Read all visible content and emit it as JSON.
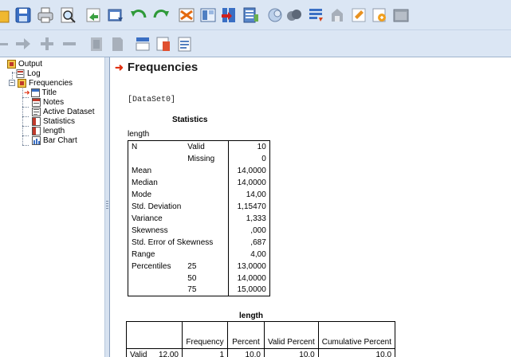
{
  "toolbar_row1": {
    "icons": [
      "open-folder-icon",
      "save-icon",
      "print-icon",
      "print-preview-icon",
      "export-icon",
      "recall-dialog-icon",
      "undo-icon",
      "redo-icon",
      "goto-case-icon",
      "goto-variable-icon",
      "split-file-icon",
      "weight-cases-icon",
      "select-cases-icon",
      "value-labels-icon",
      "use-sets-icon",
      "show-all-variables-icon",
      "spell-check-icon",
      "scripts-icon",
      "designate-window-icon"
    ]
  },
  "toolbar_row2": {
    "icons": [
      "promote-icon",
      "demote-icon",
      "expand-icon",
      "collapse-icon",
      "show-icon",
      "hide-icon",
      "insert-heading-icon",
      "insert-title-icon",
      "insert-text-icon"
    ]
  },
  "outline": {
    "root": "Output",
    "log": "Log",
    "frequencies": "Frequencies",
    "children": [
      "Title",
      "Notes",
      "Active Dataset",
      "Statistics",
      "length",
      "Bar Chart"
    ]
  },
  "output": {
    "heading": "Frequencies",
    "dataset": "[DataSet0]",
    "statistics": {
      "title": "Statistics",
      "variable": "length",
      "rows": [
        {
          "c1": "N",
          "c2": "Valid",
          "value": "10"
        },
        {
          "c1": "",
          "c2": "Missing",
          "value": "0"
        },
        {
          "c1": "Mean",
          "c2": "",
          "value": "14,0000"
        },
        {
          "c1": "Median",
          "c2": "",
          "value": "14,0000"
        },
        {
          "c1": "Mode",
          "c2": "",
          "value": "14,00"
        },
        {
          "c1": "Std. Deviation",
          "c2": "",
          "value": "1,15470"
        },
        {
          "c1": "Variance",
          "c2": "",
          "value": "1,333"
        },
        {
          "c1": "Skewness",
          "c2": "",
          "value": ",000"
        },
        {
          "c1": "Std. Error of Skewness",
          "c2": "",
          "value": ",687"
        },
        {
          "c1": "Range",
          "c2": "",
          "value": "4,00"
        },
        {
          "c1": "Percentiles",
          "c2": "25",
          "value": "13,0000"
        },
        {
          "c1": "",
          "c2": "50",
          "value": "14,0000"
        },
        {
          "c1": "",
          "c2": "75",
          "value": "15,0000"
        }
      ]
    },
    "frequency_table": {
      "title": "length",
      "headers": [
        "Frequency",
        "Percent",
        "Valid Percent",
        "Cumulative Percent"
      ],
      "rows": [
        {
          "group": "Valid",
          "label": "12,00",
          "frequency": "1",
          "percent": "10,0",
          "valid_percent": "10,0",
          "cumulative": "10,0"
        }
      ]
    }
  }
}
